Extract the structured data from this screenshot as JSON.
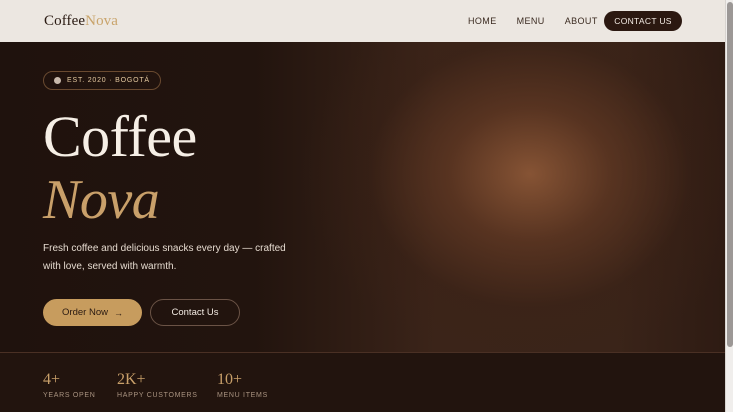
{
  "header": {
    "logo_part1": "Coffee",
    "logo_part2": "Nova",
    "nav": [
      {
        "label": "HOME"
      },
      {
        "label": "MENU"
      },
      {
        "label": "ABOUT"
      }
    ],
    "contact_label": "CONTACT US"
  },
  "hero": {
    "badge": "EST. 2020 · BOGOTÁ",
    "title_line1": "Coffee",
    "title_line2": "Nova",
    "description": "Fresh coffee and delicious snacks every day — crafted with love, served with warmth.",
    "primary_cta": "Order Now",
    "primary_cta_icon": "→",
    "secondary_cta": "Contact Us"
  },
  "stats": [
    {
      "value": "4+",
      "label": "YEARS OPEN"
    },
    {
      "value": "2K+",
      "label": "HAPPY CUSTOMERS"
    },
    {
      "value": "10+",
      "label": "MENU ITEMS"
    }
  ],
  "colors": {
    "accent": "#c9a06a",
    "dark": "#2b1810",
    "header_bg": "#ece7e1"
  }
}
